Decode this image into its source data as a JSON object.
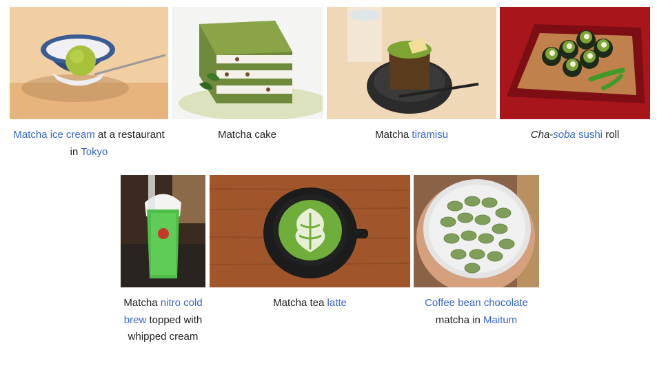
{
  "gallery": {
    "items": [
      {
        "image_alt": "Matcha ice cream",
        "caption": {
          "link1": "Matcha ice cream",
          "text1": " at a restaurant in ",
          "link2": "Tokyo"
        }
      },
      {
        "image_alt": "Matcha cake",
        "caption": {
          "text1": "Matcha cake"
        }
      },
      {
        "image_alt": "Matcha tiramisu",
        "caption": {
          "text1": "Matcha ",
          "link1": "tiramisu"
        }
      },
      {
        "image_alt": "Cha-soba sushi roll",
        "caption": {
          "italic1": "Cha-",
          "italic_link": "soba",
          "text_space": " ",
          "link1": "sushi",
          "text1": " roll"
        }
      },
      {
        "image_alt": "Matcha nitro cold brew",
        "caption": {
          "text1": "Matcha ",
          "link1": "nitro cold brew",
          "text2": " topped with whipped cream"
        }
      },
      {
        "image_alt": "Matcha tea latte",
        "caption": {
          "text1": "Matcha tea ",
          "link1": "latte"
        }
      },
      {
        "image_alt": "Coffee bean chocolate matcha",
        "caption": {
          "link1": "Coffee bean chocolate",
          "text1": " matcha in ",
          "link2": "Maitum"
        }
      }
    ]
  },
  "colors": {
    "link": "#3366cc",
    "text": "#202122",
    "matcha_green": "#8dbb2f"
  }
}
